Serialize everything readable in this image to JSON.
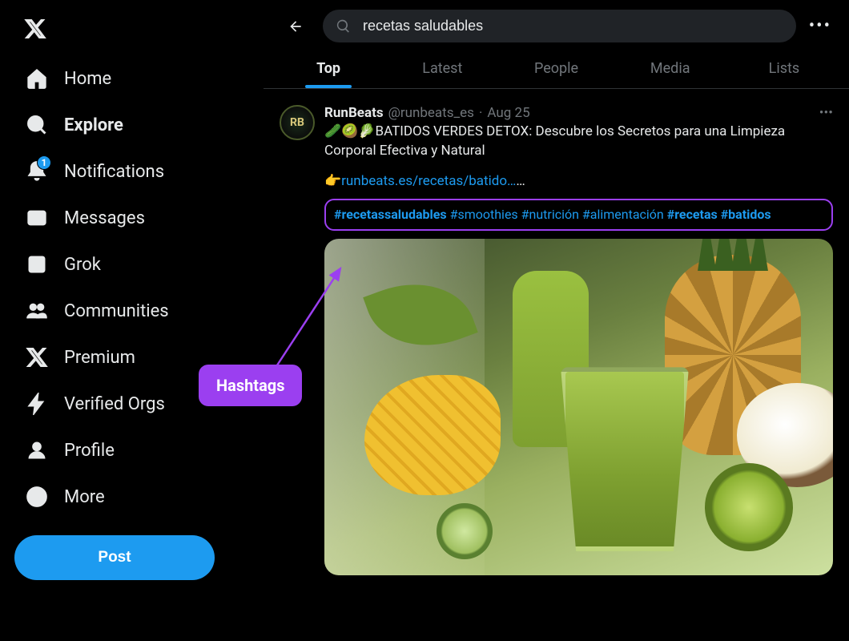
{
  "sidebar": {
    "items": [
      {
        "label": "Home",
        "icon": "home-icon"
      },
      {
        "label": "Explore",
        "icon": "search-icon",
        "active": true
      },
      {
        "label": "Notifications",
        "icon": "bell-icon",
        "badge": "1"
      },
      {
        "label": "Messages",
        "icon": "envelope-icon"
      },
      {
        "label": "Grok",
        "icon": "grok-icon"
      },
      {
        "label": "Communities",
        "icon": "people-icon"
      },
      {
        "label": "Premium",
        "icon": "x-icon"
      },
      {
        "label": "Verified Orgs",
        "icon": "bolt-icon"
      },
      {
        "label": "Profile",
        "icon": "person-icon"
      },
      {
        "label": "More",
        "icon": "more-circle-icon"
      }
    ],
    "post_label": "Post"
  },
  "search": {
    "value": "recetas saludables"
  },
  "tabs": [
    {
      "label": "Top",
      "active": true
    },
    {
      "label": "Latest"
    },
    {
      "label": "People"
    },
    {
      "label": "Media"
    },
    {
      "label": "Lists"
    }
  ],
  "tweet": {
    "avatar_text": "RB",
    "display_name": "RunBeats",
    "handle": "@runbeats_es",
    "sep": "·",
    "date": "Aug 25",
    "line1": "🥒🥝🥬BATIDOS VERDES DETOX: Descubre los Secretos para una Limpieza Corporal Efectiva y Natural",
    "link_prefix": "👉",
    "link_text": "runbeats.es/recetas/batido…",
    "link_suffix": "…",
    "hashtags": [
      {
        "text": "#recetassaludables",
        "bold": true
      },
      {
        "text": "#smoothies"
      },
      {
        "text": "#nutrición"
      },
      {
        "text": "#alimentación"
      },
      {
        "text": "#recetas",
        "bold": true
      },
      {
        "text": "#batidos",
        "bold": true
      }
    ]
  },
  "annotation": {
    "label": "Hashtags"
  },
  "colors": {
    "accent": "#1d9bf0",
    "annotation": "#9b3ff0"
  }
}
